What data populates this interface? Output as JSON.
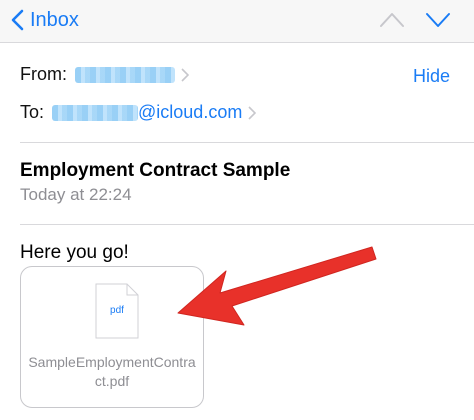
{
  "navbar": {
    "back_label": "Inbox",
    "up_icon": "chevron-up-icon",
    "down_icon": "chevron-down-icon"
  },
  "header": {
    "from_label": "From:",
    "to_label": "To:",
    "to_domain": "@icloud.com",
    "hide_label": "Hide"
  },
  "message": {
    "subject": "Employment Contract Sample",
    "date": "Today at 22:24",
    "body": "Here you go!"
  },
  "attachment": {
    "ext": "pdf",
    "name_line1": "SampleEmploymentContra",
    "name_line2": "ct.pdf"
  },
  "colors": {
    "accent": "#1a7cf5",
    "arrow": "#e8312a",
    "secondary_text": "#8e8e93"
  }
}
